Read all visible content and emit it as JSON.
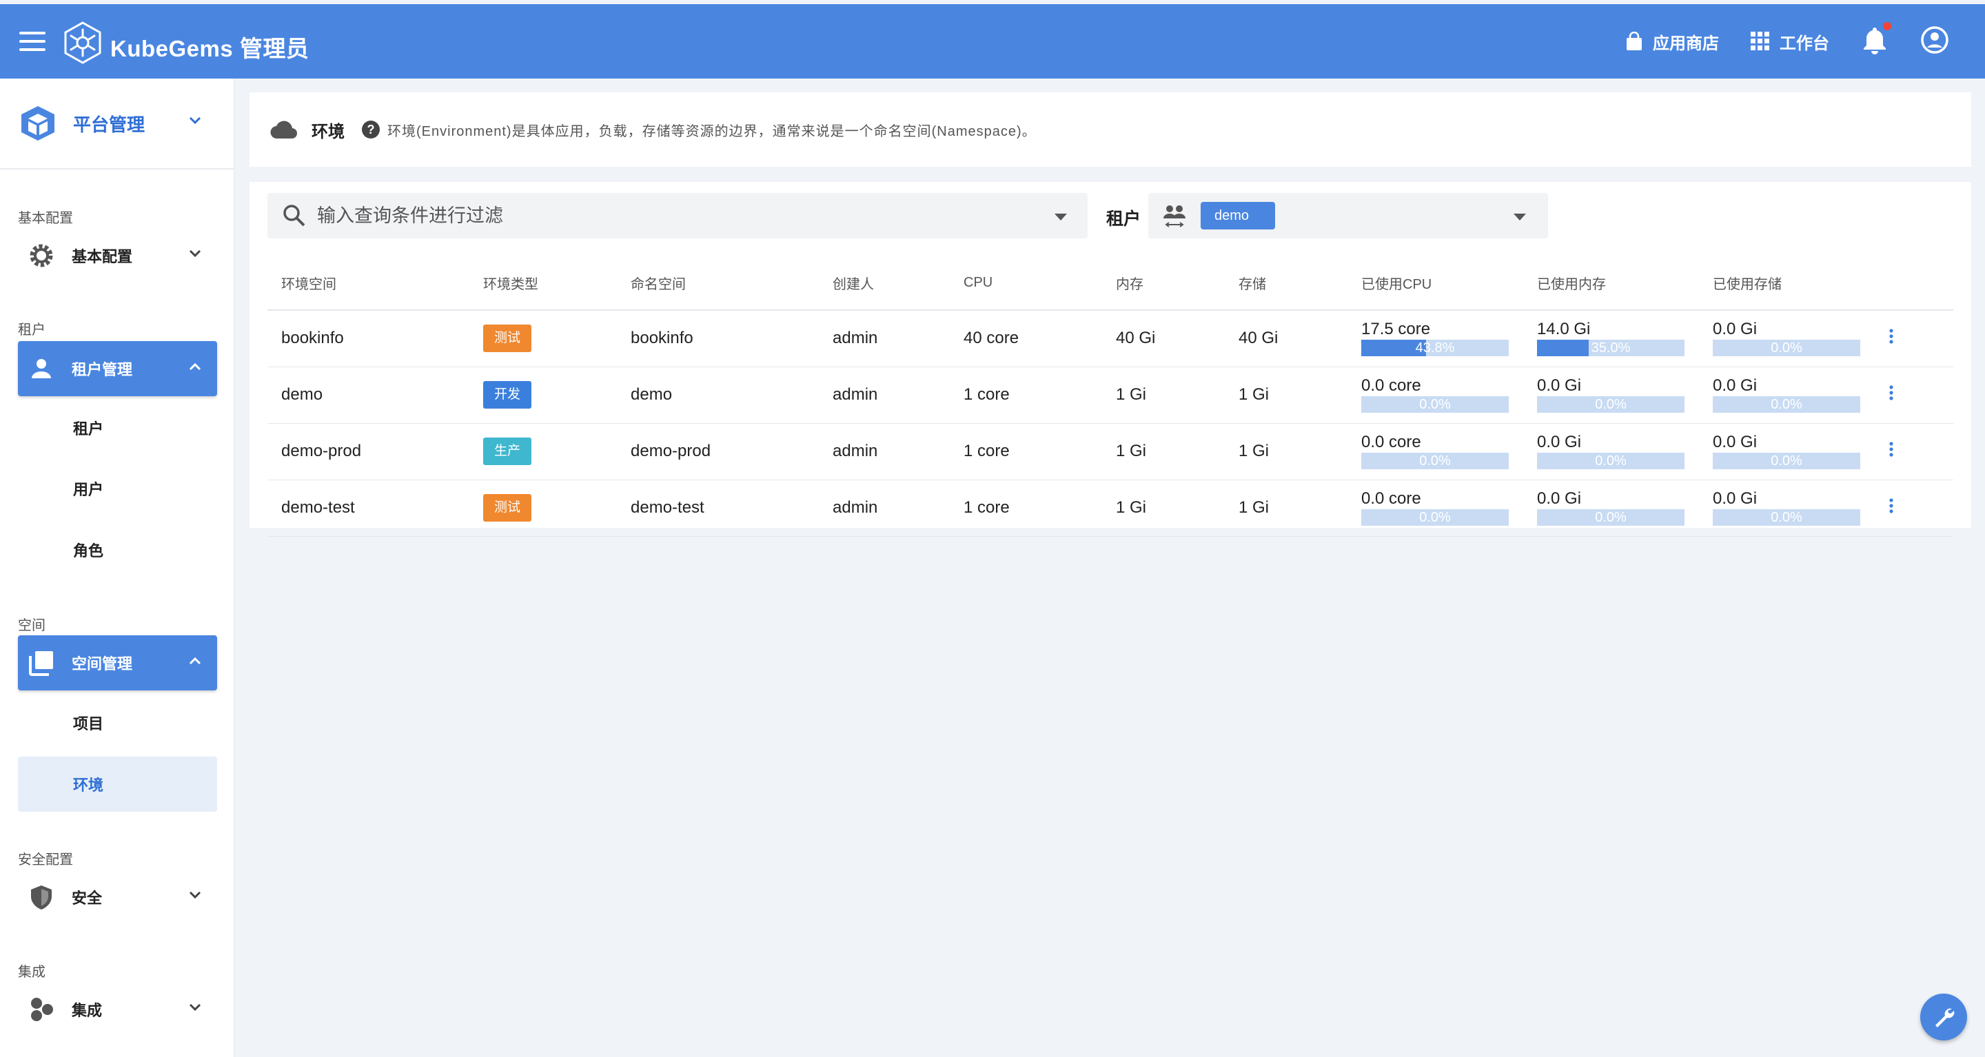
{
  "topbar": {
    "brand": "KubeGems 管理员",
    "app_store": "应用商店",
    "workbench": "工作台"
  },
  "sidebar": {
    "platform": "平台管理",
    "groups": {
      "basic": "基本配置",
      "tenant": "租户",
      "space": "空间",
      "security": "安全配置",
      "integration": "集成"
    },
    "items": {
      "basic_config": "基本配置",
      "tenant_mgmt": "租户管理",
      "tenant": "租户",
      "user": "用户",
      "role": "角色",
      "space_mgmt": "空间管理",
      "project": "项目",
      "environment": "环境",
      "security": "安全",
      "integration": "集成"
    }
  },
  "header": {
    "title": "环境",
    "description": "环境(Environment)是具体应用，负载，存储等资源的边界，通常来说是一个命名空间(Namespace)。"
  },
  "filter": {
    "search_placeholder": "输入查询条件进行过滤",
    "tenant_label": "租户",
    "tenant_value": "demo"
  },
  "table": {
    "headers": [
      "环境空间",
      "环境类型",
      "命名空间",
      "创建人",
      "CPU",
      "内存",
      "存储",
      "已使用CPU",
      "已使用内存",
      "已使用存储"
    ],
    "rows": [
      {
        "env": "bookinfo",
        "type": "测试",
        "type_color": "#f0882f",
        "namespace": "bookinfo",
        "creator": "admin",
        "cpu": "40 core",
        "mem": "40 Gi",
        "storage": "40 Gi",
        "used_cpu": "17.5 core",
        "used_cpu_pct": "43.8%",
        "used_cpu_frac": 0.438,
        "used_mem": "14.0 Gi",
        "used_mem_pct": "35.0%",
        "used_mem_frac": 0.35,
        "used_storage": "0.0 Gi",
        "used_storage_pct": "0.0%",
        "used_storage_frac": 0
      },
      {
        "env": "demo",
        "type": "开发",
        "type_color": "#3b7fdc",
        "namespace": "demo",
        "creator": "admin",
        "cpu": "1 core",
        "mem": "1 Gi",
        "storage": "1 Gi",
        "used_cpu": "0.0 core",
        "used_cpu_pct": "0.0%",
        "used_cpu_frac": 0,
        "used_mem": "0.0 Gi",
        "used_mem_pct": "0.0%",
        "used_mem_frac": 0,
        "used_storage": "0.0 Gi",
        "used_storage_pct": "0.0%",
        "used_storage_frac": 0
      },
      {
        "env": "demo-prod",
        "type": "生产",
        "type_color": "#3fb7cf",
        "namespace": "demo-prod",
        "creator": "admin",
        "cpu": "1 core",
        "mem": "1 Gi",
        "storage": "1 Gi",
        "used_cpu": "0.0 core",
        "used_cpu_pct": "0.0%",
        "used_cpu_frac": 0,
        "used_mem": "0.0 Gi",
        "used_mem_pct": "0.0%",
        "used_mem_frac": 0,
        "used_storage": "0.0 Gi",
        "used_storage_pct": "0.0%",
        "used_storage_frac": 0
      },
      {
        "env": "demo-test",
        "type": "测试",
        "type_color": "#f0882f",
        "namespace": "demo-test",
        "creator": "admin",
        "cpu": "1 core",
        "mem": "1 Gi",
        "storage": "1 Gi",
        "used_cpu": "0.0 core",
        "used_cpu_pct": "0.0%",
        "used_cpu_frac": 0,
        "used_mem": "0.0 Gi",
        "used_mem_pct": "0.0%",
        "used_mem_frac": 0,
        "used_storage": "0.0 Gi",
        "used_storage_pct": "0.0%",
        "used_storage_frac": 0
      }
    ]
  },
  "colors": {
    "primary": "#4a86e0",
    "bar_track": "#c8dbf3",
    "notify_dot": "#f44336"
  }
}
